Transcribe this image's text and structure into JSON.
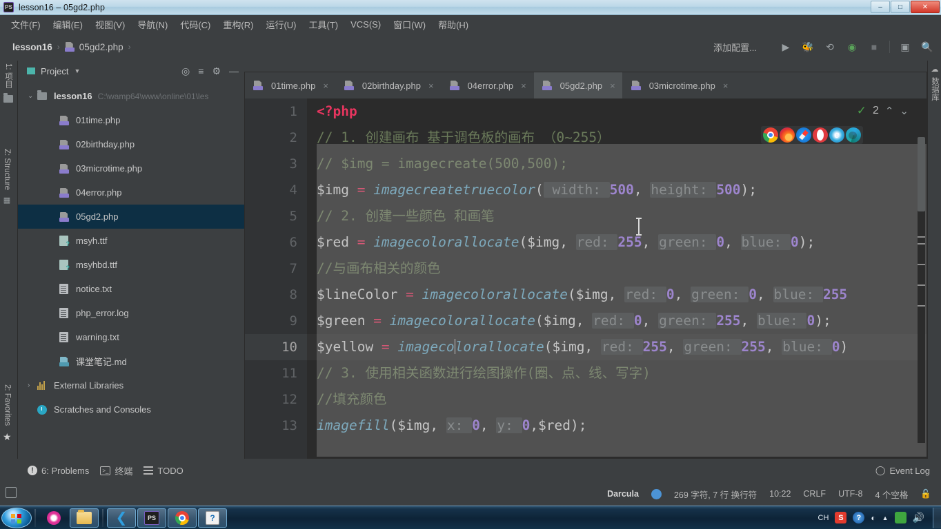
{
  "window": {
    "title": "lesson16 – 05gd2.php",
    "app_icon": "phpstorm-icon",
    "minimize": "–",
    "maximize": "□",
    "close": "✕"
  },
  "menubar": {
    "items": [
      "文件(F)",
      "编辑(E)",
      "视图(V)",
      "导航(N)",
      "代码(C)",
      "重构(R)",
      "运行(U)",
      "工具(T)",
      "VCS(S)",
      "窗口(W)",
      "帮助(H)"
    ]
  },
  "navbar": {
    "breadcrumbs": [
      "lesson16",
      "05gd2.php"
    ],
    "add_config": "添加配置...",
    "icons": [
      "run-icon",
      "debug-icon",
      "run-coverage-icon",
      "profile-icon",
      "stop-icon",
      "layout-icon",
      "search-everywhere-icon"
    ]
  },
  "left_tool_strip": {
    "items": [
      "1: 项目",
      "Z: Structure",
      "2: Favorites"
    ]
  },
  "right_tool_strip": {
    "items": [
      "数据库"
    ]
  },
  "project_panel": {
    "title": "Project",
    "actions": [
      "locate-icon",
      "collapse-all-icon",
      "settings-icon",
      "hide-icon"
    ],
    "tree": [
      {
        "label": "lesson16",
        "path": "C:\\wamp64\\www\\online\\01\\les",
        "icon": "folder-icon",
        "bold": true,
        "expanded": true,
        "indent": 0,
        "selected": false
      },
      {
        "label": "01time.php",
        "path": "",
        "icon": "php-file-icon",
        "bold": false,
        "indent": 1,
        "selected": false
      },
      {
        "label": "02birthday.php",
        "path": "",
        "icon": "php-file-icon",
        "bold": false,
        "indent": 1,
        "selected": false
      },
      {
        "label": "03microtime.php",
        "path": "",
        "icon": "php-file-icon",
        "bold": false,
        "indent": 1,
        "selected": false
      },
      {
        "label": "04error.php",
        "path": "",
        "icon": "php-file-icon",
        "bold": false,
        "indent": 1,
        "selected": false
      },
      {
        "label": "05gd2.php",
        "path": "",
        "icon": "php-file-icon",
        "bold": false,
        "indent": 1,
        "selected": true
      },
      {
        "label": "msyh.ttf",
        "path": "",
        "icon": "font-file-icon",
        "bold": false,
        "indent": 1,
        "selected": false
      },
      {
        "label": "msyhbd.ttf",
        "path": "",
        "icon": "font-file-icon",
        "bold": false,
        "indent": 1,
        "selected": false
      },
      {
        "label": "notice.txt",
        "path": "",
        "icon": "text-file-icon",
        "bold": false,
        "indent": 1,
        "selected": false
      },
      {
        "label": "php_error.log",
        "path": "",
        "icon": "text-file-icon",
        "bold": false,
        "indent": 1,
        "selected": false
      },
      {
        "label": "warning.txt",
        "path": "",
        "icon": "text-file-icon",
        "bold": false,
        "indent": 1,
        "selected": false
      },
      {
        "label": "课堂笔记.md",
        "path": "",
        "icon": "markdown-file-icon",
        "bold": false,
        "indent": 1,
        "selected": false
      },
      {
        "label": "External Libraries",
        "path": "",
        "icon": "library-icon",
        "bold": false,
        "indent": 0,
        "selected": false,
        "collapsed": true
      },
      {
        "label": "Scratches and Consoles",
        "path": "",
        "icon": "scratches-icon",
        "bold": false,
        "indent": 0,
        "selected": false
      }
    ]
  },
  "editor": {
    "tabs": [
      {
        "label": "01time.php",
        "active": false
      },
      {
        "label": "02birthday.php",
        "active": false
      },
      {
        "label": "04error.php",
        "active": false
      },
      {
        "label": "05gd2.php",
        "active": true
      },
      {
        "label": "03microtime.php",
        "active": false
      }
    ],
    "tab_close": "×",
    "inspection": {
      "check": "✓",
      "count": "2",
      "prev": "⌃",
      "next": "⌄"
    },
    "browser_popup": [
      "chrome-icon",
      "firefox-icon",
      "safari-icon",
      "opera-icon",
      "ie-icon",
      "edge-icon"
    ],
    "current_line": 10,
    "line_numbers": [
      "1",
      "2",
      "3",
      "4",
      "5",
      "6",
      "7",
      "8",
      "9",
      "10",
      "11",
      "12",
      "13"
    ],
    "code_lines": [
      {
        "n": 1,
        "parts": [
          {
            "t": "<?php",
            "c": "kw"
          }
        ]
      },
      {
        "n": 2,
        "parts": [
          {
            "t": "//    1. 创建画布  基于调色板的画布 （0~255）",
            "c": "cm"
          }
        ]
      },
      {
        "n": 3,
        "parts": [
          {
            "t": "//    $img = imagecreate(500,500);",
            "c": "cm"
          }
        ]
      },
      {
        "n": 4,
        "parts": [
          {
            "t": "$img ",
            "c": "var"
          },
          {
            "t": "= ",
            "c": "op"
          },
          {
            "t": "imagecreatetruecolor",
            "c": "fn"
          },
          {
            "t": "(",
            "c": "pun"
          },
          {
            "t": " width: ",
            "c": "hint"
          },
          {
            "t": "500",
            "c": "num"
          },
          {
            "t": ", ",
            "c": "pun"
          },
          {
            "t": " height: ",
            "c": "hint"
          },
          {
            "t": "500",
            "c": "num"
          },
          {
            "t": ");",
            "c": "pun"
          }
        ]
      },
      {
        "n": 5,
        "parts": [
          {
            "t": "//    2. 创建一些颜色 和画笔",
            "c": "cm"
          }
        ]
      },
      {
        "n": 6,
        "parts": [
          {
            "t": "$red ",
            "c": "var"
          },
          {
            "t": "= ",
            "c": "op"
          },
          {
            "t": "imagecolorallocate",
            "c": "fn"
          },
          {
            "t": "($img, ",
            "c": "pun"
          },
          {
            "t": " red: ",
            "c": "hint"
          },
          {
            "t": "255",
            "c": "num"
          },
          {
            "t": ", ",
            "c": "pun"
          },
          {
            "t": " green: ",
            "c": "hint"
          },
          {
            "t": "0",
            "c": "num"
          },
          {
            "t": ", ",
            "c": "pun"
          },
          {
            "t": " blue: ",
            "c": "hint"
          },
          {
            "t": "0",
            "c": "num"
          },
          {
            "t": ");",
            "c": "pun"
          }
        ]
      },
      {
        "n": 7,
        "parts": [
          {
            "t": "//与画布相关的颜色",
            "c": "cm"
          }
        ]
      },
      {
        "n": 8,
        "parts": [
          {
            "t": "$lineColor ",
            "c": "var"
          },
          {
            "t": "= ",
            "c": "op"
          },
          {
            "t": "imagecolorallocate",
            "c": "fn"
          },
          {
            "t": "($img, ",
            "c": "pun"
          },
          {
            "t": " red: ",
            "c": "hint"
          },
          {
            "t": "0",
            "c": "num"
          },
          {
            "t": ", ",
            "c": "pun"
          },
          {
            "t": " green: ",
            "c": "hint"
          },
          {
            "t": "0",
            "c": "num"
          },
          {
            "t": ", ",
            "c": "pun"
          },
          {
            "t": " blue: ",
            "c": "hint"
          },
          {
            "t": "255",
            "c": "num"
          }
        ]
      },
      {
        "n": 9,
        "parts": [
          {
            "t": "$green ",
            "c": "var"
          },
          {
            "t": "= ",
            "c": "op"
          },
          {
            "t": "imagecolorallocate",
            "c": "fn"
          },
          {
            "t": "($img, ",
            "c": "pun"
          },
          {
            "t": " red: ",
            "c": "hint"
          },
          {
            "t": "0",
            "c": "num"
          },
          {
            "t": ", ",
            "c": "pun"
          },
          {
            "t": " green: ",
            "c": "hint"
          },
          {
            "t": "255",
            "c": "num"
          },
          {
            "t": ", ",
            "c": "pun"
          },
          {
            "t": " blue: ",
            "c": "hint"
          },
          {
            "t": "0",
            "c": "num"
          },
          {
            "t": ");",
            "c": "pun"
          }
        ]
      },
      {
        "n": 10,
        "parts": [
          {
            "t": "$yellow ",
            "c": "var"
          },
          {
            "t": "= ",
            "c": "op"
          },
          {
            "t": "imageco",
            "c": "fn"
          },
          {
            "t": "|",
            "c": "caret"
          },
          {
            "t": "lorallocate",
            "c": "fn"
          },
          {
            "t": "($img, ",
            "c": "pun"
          },
          {
            "t": " red: ",
            "c": "hint"
          },
          {
            "t": "255",
            "c": "num"
          },
          {
            "t": ", ",
            "c": "pun"
          },
          {
            "t": " green: ",
            "c": "hint"
          },
          {
            "t": "255",
            "c": "num"
          },
          {
            "t": ", ",
            "c": "pun"
          },
          {
            "t": " blue: ",
            "c": "hint"
          },
          {
            "t": "0",
            "c": "num"
          },
          {
            "t": ")",
            "c": "pun"
          }
        ]
      },
      {
        "n": 11,
        "parts": [
          {
            "t": "//    3. 使用相关函数进行绘图操作(圈、点、线、写字)",
            "c": "cm"
          }
        ]
      },
      {
        "n": 12,
        "parts": [
          {
            "t": "//填充颜色",
            "c": "cm"
          }
        ]
      },
      {
        "n": 13,
        "parts": [
          {
            "t": "imagefill",
            "c": "fn"
          },
          {
            "t": "($img, ",
            "c": "pun"
          },
          {
            "t": " x: ",
            "c": "hint"
          },
          {
            "t": "0",
            "c": "num"
          },
          {
            "t": ", ",
            "c": "pun"
          },
          {
            "t": " y: ",
            "c": "hint"
          },
          {
            "t": "0",
            "c": "num"
          },
          {
            "t": ",$red);",
            "c": "pun"
          }
        ]
      }
    ]
  },
  "bottom_bar": {
    "items": [
      {
        "label": "6: Problems",
        "icon": "warning-icon"
      },
      {
        "label": "终端",
        "icon": "terminal-icon"
      },
      {
        "label": "TODO",
        "icon": "todo-icon"
      }
    ],
    "event_log": "Event Log",
    "event_log_icon": "event-log-icon"
  },
  "status_bar": {
    "lock_icon": "lock-icon",
    "theme": "Darcula",
    "theme_dot": "theme-indicator",
    "stats": "269 字符, 7 行 换行符",
    "caret_position": "10:22",
    "line_separator": "CRLF",
    "encoding": "UTF-8",
    "indent": "4 个空格",
    "readonly_icon": "write-lock-icon"
  },
  "taskbar": {
    "start": "start-orb-icon",
    "quick_launch": [
      "ie-icon",
      "explorer-icon"
    ],
    "running": [
      "vscode-icon",
      "phpstorm-icon",
      "chrome-icon",
      "help-icon"
    ],
    "tray": {
      "ime": "CH",
      "items": [
        "sogou-icon",
        "qq-icon",
        "network-icon",
        "show-hidden-icon",
        "wamp-icon",
        "volume-icon"
      ]
    },
    "show_desktop": "show-desktop-button"
  },
  "colors": {
    "accent": "#4c94d6",
    "keyword": "#e8355f",
    "function": "#6aa9c4",
    "comment": "#6a7a5a",
    "number": "#9876dd",
    "selection": "#0d2f44",
    "panel_bg": "#3c3f41",
    "editor_bg": "#2b2b2b"
  }
}
